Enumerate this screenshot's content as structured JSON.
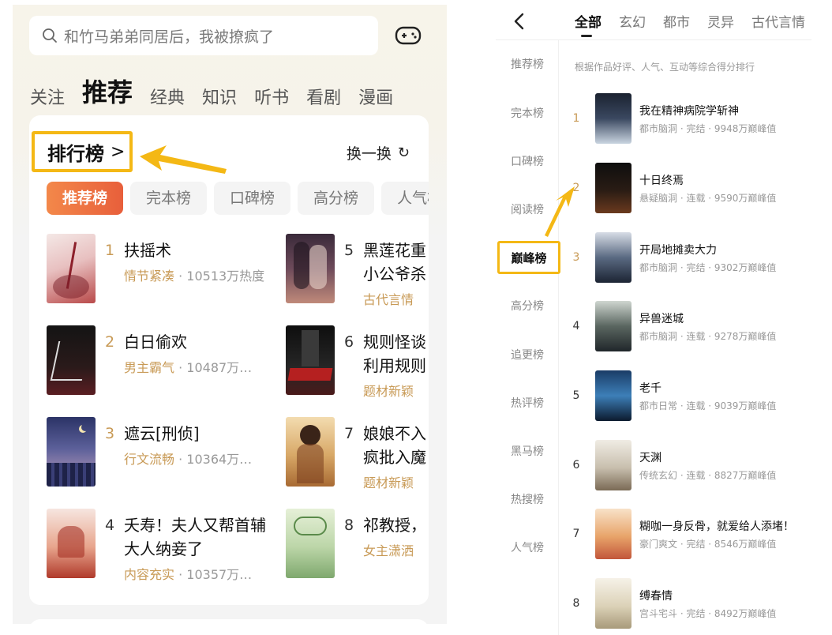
{
  "left": {
    "search": {
      "placeholder": "和竹马弟弟同居后，我被撩疯了",
      "icon": "search-icon"
    },
    "game_icon": "gamepad-icon",
    "nav_tabs": [
      "关注",
      "推荐",
      "经典",
      "知识",
      "听书",
      "看剧",
      "漫画"
    ],
    "active_tab": "推荐",
    "ranking": {
      "title": "排行榜",
      "title_chevron": ">",
      "refresh_label": "换一换",
      "highlight_color": "#f4b815",
      "chips": [
        "推荐榜",
        "完本榜",
        "口碑榜",
        "高分榜",
        "人气榜"
      ],
      "active_chip": "推荐榜",
      "books": [
        {
          "rank": "1",
          "name": "扶摇术",
          "tag": "情节紧凑",
          "stat": "10513万热度"
        },
        {
          "rank": "2",
          "name": "白日偷欢",
          "tag": "男主霸气",
          "stat": "10487万…"
        },
        {
          "rank": "3",
          "name": "遮云[刑侦]",
          "tag": "行文流畅",
          "stat": "10364万…"
        },
        {
          "rank": "4",
          "name": "夭寿！夫人又帮首辅大人纳妾了",
          "name_line1": "夭寿！夫人又帮首辅",
          "name_line2": "大人纳妾了",
          "tag": "内容充实",
          "stat": "10357万…"
        },
        {
          "rank": "5",
          "name_line1": "黑莲花重",
          "name_line2": "小公爷杀",
          "tag": "古代言情"
        },
        {
          "rank": "6",
          "name_line1": "规则怪谈",
          "name_line2": "利用规则",
          "tag": "题材新颖"
        },
        {
          "rank": "7",
          "name_line1": "娘娘不入",
          "name_line2": "疯批入魔",
          "tag": "题材新颖"
        },
        {
          "rank": "8",
          "name": "祁教授，",
          "tag": "女主潇洒"
        }
      ]
    }
  },
  "right": {
    "tabs": [
      "全部",
      "玄幻",
      "都市",
      "灵异",
      "古代言情"
    ],
    "active_tab": "全部",
    "side_items": [
      "推荐榜",
      "完本榜",
      "口碑榜",
      "阅读榜",
      "巅峰榜",
      "高分榜",
      "追更榜",
      "热评榜",
      "黑马榜",
      "热搜榜",
      "人气榜"
    ],
    "active_side": "巅峰榜",
    "description": "根据作品好评、人气、互动等综合得分排行",
    "books": [
      {
        "rank": "1",
        "name": "我在精神病院学斩神",
        "meta": "都市脑洞 · 完结 · 9948万巅峰值"
      },
      {
        "rank": "2",
        "name": "十日终焉",
        "meta": "悬疑脑洞 · 连载 · 9590万巅峰值"
      },
      {
        "rank": "3",
        "name": "开局地摊卖大力",
        "meta": "都市脑洞 · 完结 · 9302万巅峰值"
      },
      {
        "rank": "4",
        "name": "异兽迷城",
        "meta": "都市脑洞 · 连载 · 9278万巅峰值"
      },
      {
        "rank": "5",
        "name": "老千",
        "meta": "都市日常 · 连载 · 9039万巅峰值"
      },
      {
        "rank": "6",
        "name": "天渊",
        "meta": "传统玄幻 · 连载 · 8827万巅峰值"
      },
      {
        "rank": "7",
        "name": "糊咖一身反骨，就爱给人添堵！",
        "meta": "豪门爽文 · 完结 · 8546万巅峰值"
      },
      {
        "rank": "8",
        "name": "缚春情",
        "meta": "宫斗宅斗 · 完结 · 8492万巅峰值"
      }
    ]
  }
}
